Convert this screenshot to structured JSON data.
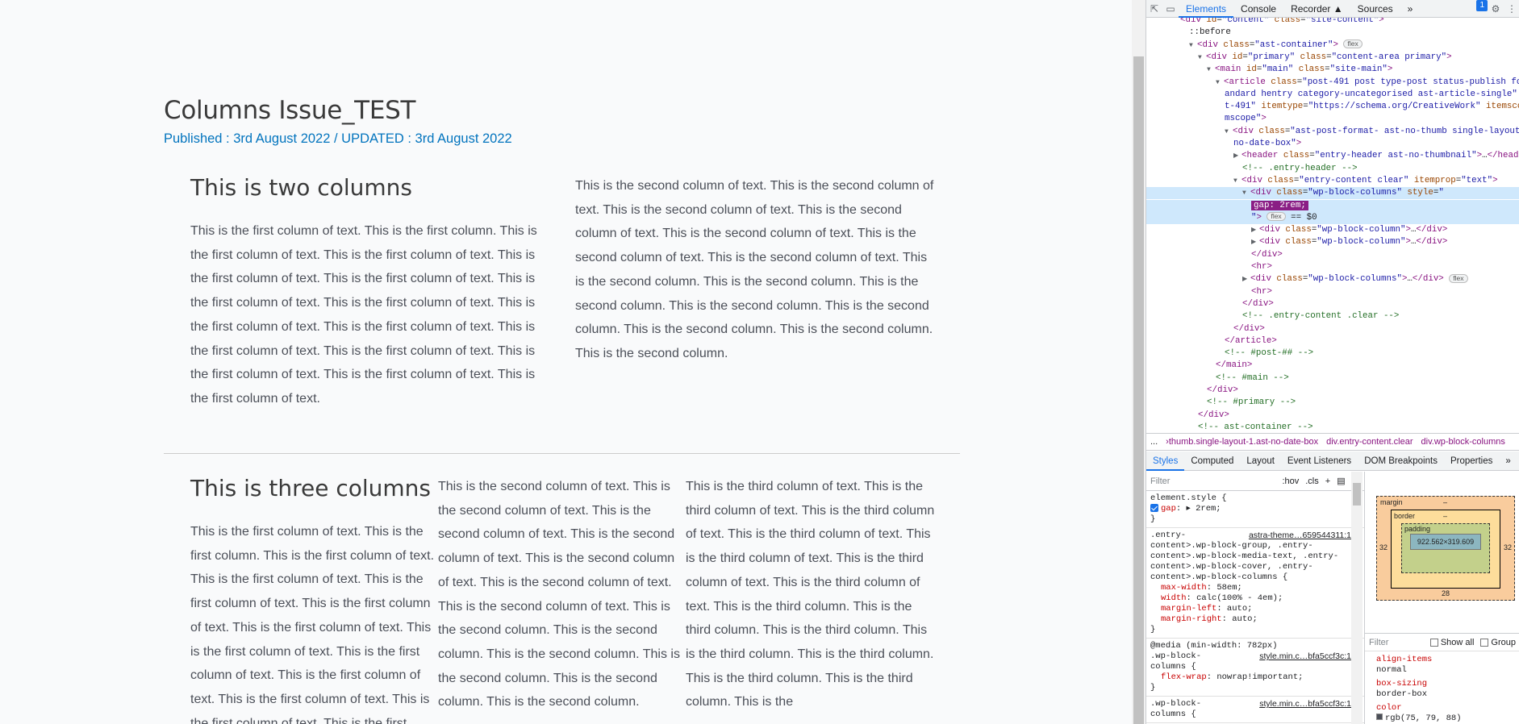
{
  "page": {
    "title": "Columns Issue_TEST",
    "meta": "Published : 3rd August 2022 / UPDATED : 3rd August 2022",
    "section1": {
      "heading": "This is two columns",
      "col1": "This is the first column of text. This is the first column. This is the first column of text. This is the first column of text. This is the first column of text. This is the first column of text. This is the first column of text. This is the first column of text. This is the first column of text. This is the first column of text. This is the first column of text. This is the first column of text. This is the first column of text. This is the first column of text. This is the first column of text.",
      "col2": "This is the second column of text. This is the second column of text. This is the second column of text. This is the second column of text. This is the second column of text. This is the second column of text. This is the second column of text. This is the second column. This is the second column. This is the second column. This is the second column. This is the second column. This is the second column. This is the second column. This is the second column."
    },
    "section2": {
      "heading": "This is three columns",
      "col1": "This is the first column of text. This is the first column. This is the first column of text. This is the first column of text. This is the first column of text. This is the first column of text. This is the first column of text. This is the first column of text. This is the first column of text. This is the first column of text. This is the first column of text. This is the first column of text. This is the first",
      "col2": "This is the second column of text. This is the second column of text. This is the second column of text. This is the second column of text. This is the second column of text. This is the second column of text. This is the second column of text. This is the second column. This is the second column. This is the second column. This is the second column. This is the second column. This is the second column.",
      "col3": "This is the third column of text. This is the third column of text. This is the third column of text. This is the third column of text. This is the third column of text. This is the third column of text. This is the third column of text. This is the third column. This is the third column. This is the third column. This is the third column. This is the third column. This is the third column. This is the third column. This is the"
    }
  },
  "devtools": {
    "tabs": [
      "Elements",
      "Console",
      "Recorder ▲",
      "Sources"
    ],
    "more_tabs": "»",
    "issues_badge": "1",
    "dom": [
      {
        "i": 0,
        "html": "<span class='tg'>&lt;div</span> <span class='at'>id</span>=<span class='av'>\"content\"</span> <span class='at'>class</span>=<span class='av'>\"site-content\"</span><span class='tg'>&gt;</span>"
      },
      {
        "i": 1,
        "html": "<span class='tx'>::before</span>"
      },
      {
        "i": 1,
        "html": "<span class='tri'>▼</span><span class='tg'>&lt;div</span> <span class='at'>class</span>=<span class='av'>\"ast-container\"</span><span class='tg'>&gt;</span> <span class='pill'>flex</span>"
      },
      {
        "i": 2,
        "html": "<span class='tri'>▼</span><span class='tg'>&lt;div</span> <span class='at'>id</span>=<span class='av'>\"primary\"</span> <span class='at'>class</span>=<span class='av'>\"content-area primary\"</span><span class='tg'>&gt;</span>"
      },
      {
        "i": 3,
        "html": "<span class='tri'>▼</span><span class='tg'>&lt;main</span> <span class='at'>id</span>=<span class='av'>\"main\"</span> <span class='at'>class</span>=<span class='av'>\"site-main\"</span><span class='tg'>&gt;</span>"
      },
      {
        "i": 4,
        "html": "<span class='tri'>▼</span><span class='tg'>&lt;article</span> <span class='at'>class</span>=<span class='av'>\"post-491 post type-post status-publish format-s</span>"
      },
      {
        "i": 5,
        "html": "<span class='av'>andard hentry category-uncategorised ast-article-single\"</span> <span class='at'>id</span>=<span class='av'>\"po</span>"
      },
      {
        "i": 5,
        "html": "<span class='av'>t-491\"</span> <span class='at'>itemtype</span>=<span class='av'>\"https://schema.org/CreativeWork\"</span> <span class='at'>itemscope</span>=<span class='av'>\"it</span>"
      },
      {
        "i": 5,
        "html": "<span class='av'>mscope\"</span><span class='tg'>&gt;</span>"
      },
      {
        "i": 5,
        "html": "<span class='tri'>▼</span><span class='tg'>&lt;div</span> <span class='at'>class</span>=<span class='av'>\"ast-post-format- ast-no-thumb single-layout-1 ast</span>"
      },
      {
        "i": 6,
        "html": "<span class='av'>no-date-box\"</span><span class='tg'>&gt;</span>"
      },
      {
        "i": 6,
        "html": "<span class='tri'>▶</span><span class='tg'>&lt;header</span> <span class='at'>class</span>=<span class='av'>\"entry-header ast-no-thumbnail\"</span><span class='tg'>&gt;</span>…<span class='tg'>&lt;/header&gt;</span>"
      },
      {
        "i": 7,
        "html": "<span class='cm'>&lt;!-- .entry-header --&gt;</span>"
      },
      {
        "i": 6,
        "html": "<span class='tri'>▼</span><span class='tg'>&lt;div</span> <span class='at'>class</span>=<span class='av'>\"entry-content clear\"</span> <span class='at'>itemprop</span>=<span class='av'>\"text\"</span><span class='tg'>&gt;</span>"
      },
      {
        "i": 7,
        "sel": true,
        "html": "<span class='tri'>▼</span><span class='tg'>&lt;div</span> <span class='at'>class</span>=<span class='av'>\"wp-block-columns\"</span> <span class='at'>style</span>=<span class='av'>\"</span>"
      },
      {
        "i": 8,
        "sel": true,
        "html": "<span class='gapedit'>gap: 2rem;</span>"
      },
      {
        "i": 8,
        "sel": true,
        "html": "<span class='av'>\"</span><span class='tg'>&gt;</span> <span class='pill'>flex</span> <span class='tx'>== $0</span>"
      },
      {
        "i": 8,
        "html": "<span class='tri'>▶</span><span class='tg'>&lt;div</span> <span class='at'>class</span>=<span class='av'>\"wp-block-column\"</span><span class='tg'>&gt;</span>…<span class='tg'>&lt;/div&gt;</span>"
      },
      {
        "i": 8,
        "html": "<span class='tri'>▶</span><span class='tg'>&lt;div</span> <span class='at'>class</span>=<span class='av'>\"wp-block-column\"</span><span class='tg'>&gt;</span>…<span class='tg'>&lt;/div&gt;</span>"
      },
      {
        "i": 8,
        "html": "<span class='tg'>&lt;/div&gt;</span>"
      },
      {
        "i": 8,
        "html": "<span class='tg'>&lt;hr&gt;</span>"
      },
      {
        "i": 7,
        "html": "<span class='tri'>▶</span><span class='tg'>&lt;div</span> <span class='at'>class</span>=<span class='av'>\"wp-block-columns\"</span><span class='tg'>&gt;</span>…<span class='tg'>&lt;/div&gt;</span> <span class='pill'>flex</span>"
      },
      {
        "i": 8,
        "html": "<span class='tg'>&lt;hr&gt;</span>"
      },
      {
        "i": 7,
        "html": "<span class='tg'>&lt;/div&gt;</span>"
      },
      {
        "i": 7,
        "html": "<span class='cm'>&lt;!-- .entry-content .clear --&gt;</span>"
      },
      {
        "i": 6,
        "html": "<span class='tg'>&lt;/div&gt;</span>"
      },
      {
        "i": 5,
        "html": "<span class='tg'>&lt;/article&gt;</span>"
      },
      {
        "i": 5,
        "html": "<span class='cm'>&lt;!-- #post-## --&gt;</span>"
      },
      {
        "i": 4,
        "html": "<span class='tg'>&lt;/main&gt;</span>"
      },
      {
        "i": 4,
        "html": "<span class='cm'>&lt;!-- #main --&gt;</span>"
      },
      {
        "i": 3,
        "html": "<span class='tg'>&lt;/div&gt;</span>"
      },
      {
        "i": 3,
        "html": "<span class='cm'>&lt;!-- #primary --&gt;</span>"
      },
      {
        "i": 2,
        "html": "<span class='tg'>&lt;/div&gt;</span>"
      },
      {
        "i": 2,
        "html": "<span class='cm'>&lt;!-- ast-container --&gt;</span>"
      }
    ],
    "breadcrumbs": [
      "...",
      "›thumb.single-layout-1.ast-no-date-box",
      "div.entry-content.clear",
      "div.wp-block-columns"
    ],
    "subtabs": [
      "Styles",
      "Computed",
      "Layout",
      "Event Listeners",
      "DOM Breakpoints",
      "Properties",
      "»"
    ],
    "styles_filter": "Filter",
    "styles_tools": [
      ":hov",
      ".cls",
      "+"
    ],
    "element_style": {
      "selector": "element.style {",
      "prop": "gap",
      "value": "2rem;",
      "close": "}"
    },
    "rule1": {
      "source": "astra-theme…659544311:1",
      "selector": [
        ".entry-",
        "content>.wp-block-group, .entry-",
        "content>.wp-block-media-text, .entry-",
        "content>.wp-block-cover, .entry-",
        "content>.wp-block-columns {"
      ],
      "props": [
        [
          "max-width",
          "58em;"
        ],
        [
          "width",
          "calc(100% - 4em);"
        ],
        [
          "margin-left",
          "auto;"
        ],
        [
          "margin-right",
          "auto;"
        ]
      ]
    },
    "rule2": {
      "media": "@media (min-width: 782px)",
      "source": "style.min.c…bfa5ccf3c:1",
      "selector": [
        ".wp-block-",
        "columns {"
      ],
      "props": [
        [
          "flex-wrap",
          "nowrap!important;"
        ]
      ]
    },
    "rule3": {
      "source": "style.min.c…bfa5ccf3c:1",
      "selector": [
        ".wp-block-",
        "columns {"
      ]
    },
    "box": {
      "margin": "margin",
      "border": "border",
      "padding": "padding",
      "content": "922.562×319.609",
      "dash": "–",
      "m_left": "32",
      "m_right": "32",
      "m_bottom": "28"
    },
    "computed_filter": "Filter",
    "show_all": "Show all",
    "group": "Group",
    "computed": [
      [
        "align-items",
        "normal"
      ],
      [
        "box-sizing",
        "border-box"
      ],
      [
        "color",
        "rgb(75, 79, 88)"
      ]
    ]
  }
}
